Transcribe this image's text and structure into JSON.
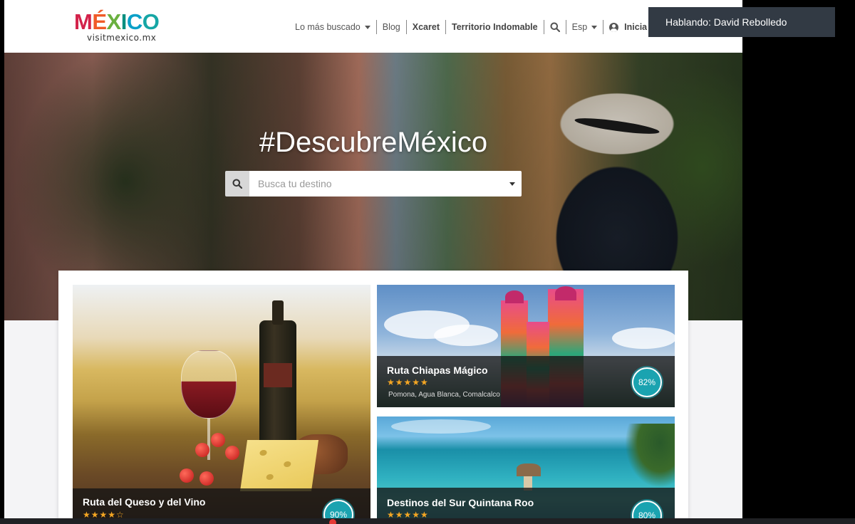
{
  "header": {
    "logo_text": "MÉXICO",
    "logo_letters": [
      "M",
      "É",
      "X",
      "I",
      "C",
      "O"
    ],
    "logo_colors": [
      "#d3224a",
      "#f05a28",
      "#6ab03f",
      "#0a8f7f",
      "#0aa0c8",
      "#16a6a5"
    ],
    "logo_sub": "visitmexico.mx",
    "nav": {
      "mas_buscado": "Lo más buscado",
      "blog": "Blog",
      "xcaret": "Xcaret",
      "territorio": "Territorio Indomable",
      "lang": "Esp",
      "inicia": "Inicia"
    }
  },
  "hero": {
    "title": "#DescubreMéxico",
    "search_placeholder": "Busca tu destino"
  },
  "cards": {
    "queso": {
      "title": "Ruta del Queso y del Vino",
      "stars": "★★★★☆",
      "percent": "90%"
    },
    "chiapas": {
      "title": "Ruta Chiapas Mágico",
      "stars": "★★★★★",
      "places": "Pomona, Agua Blanca, Comalcalco",
      "percent": "82%"
    },
    "quintana": {
      "title": "Destinos del Sur Quintana Roo",
      "stars": "★★★★★",
      "percent": "80%"
    }
  },
  "toast": {
    "text": "Hablando: David Rebolledo"
  },
  "colors": {
    "accent_teal": "#1aa3b0",
    "toast_bg": "#323a44",
    "star": "#f5a623"
  }
}
